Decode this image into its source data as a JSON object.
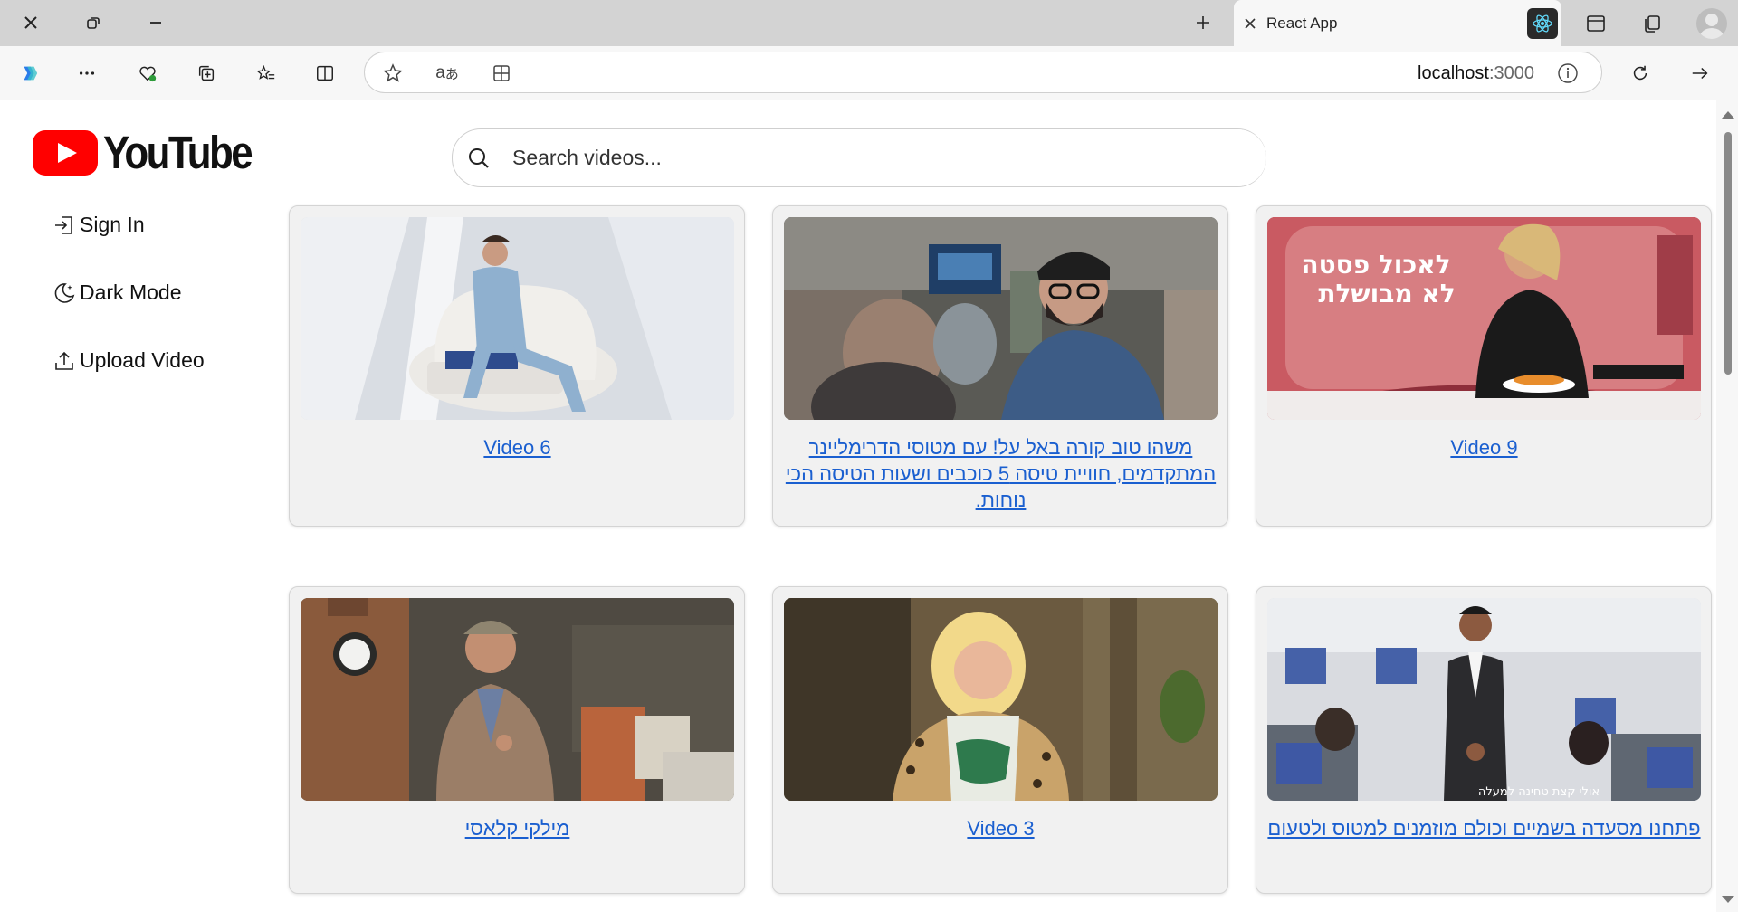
{
  "browser": {
    "tab_title": "React App",
    "url_host": "localhost",
    "url_port": ":3000"
  },
  "app": {
    "logo_text": "YouTube",
    "search_placeholder": "Search videos...",
    "sidebar": [
      {
        "label": "Sign In",
        "icon": "sign-in-icon"
      },
      {
        "label": "Dark Mode",
        "icon": "moon-icon"
      },
      {
        "label": "Upload Video",
        "icon": "upload-icon"
      }
    ],
    "videos": [
      {
        "title": "Video 6",
        "rtl": false
      },
      {
        "title": "משהו טוב קורה באל על! עם מטוסי הדרימליינר המתקדמים, חוויית טיסה 5 כוכבים ושעות הטיסה הכי נוחות.",
        "rtl": true
      },
      {
        "title": "Video 9",
        "rtl": false,
        "thumb_text_line1": "לאכול פסטה",
        "thumb_text_line2": "לא מבושלת"
      },
      {
        "title": "מילקי קלאסי",
        "rtl": true
      },
      {
        "title": "Video 3",
        "rtl": false
      },
      {
        "title": "פתחנו מסעדה בשמיים וכולם מוזמנים למטוס ולטעום",
        "rtl": true,
        "thumb_caption": "אולי קצת טחינה למעלה"
      }
    ]
  },
  "colors": {
    "accent_red": "#ff0000",
    "link_blue": "#1a5fd0",
    "card_bg": "#f1f1f1"
  }
}
